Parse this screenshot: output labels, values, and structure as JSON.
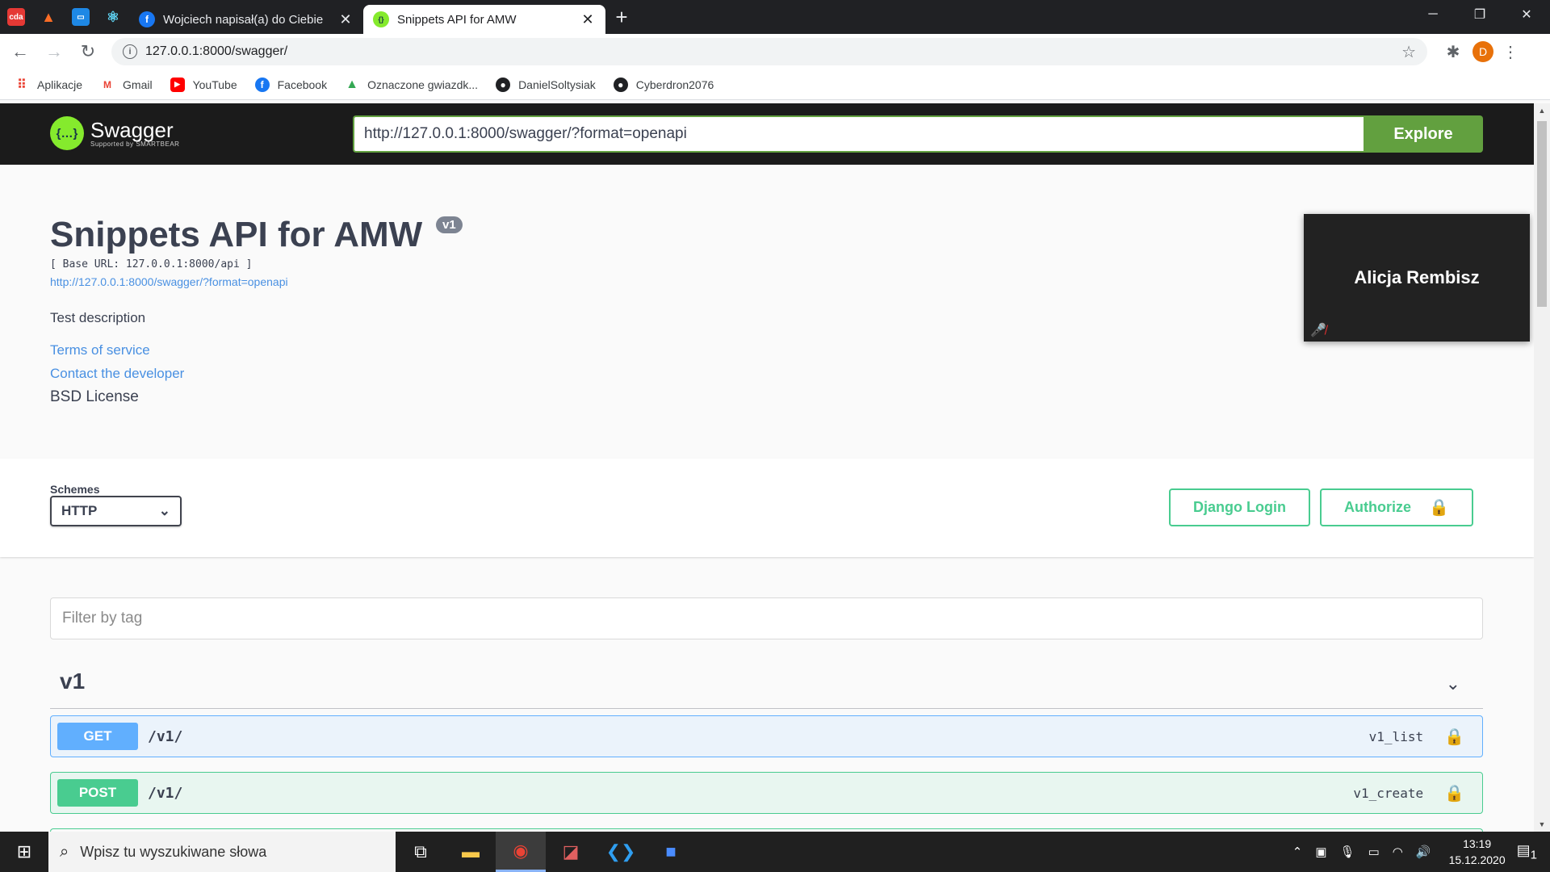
{
  "browser": {
    "pinned_tabs": [
      {
        "name": "cda",
        "label": "cda",
        "color": "#e53935"
      },
      {
        "name": "gitlab",
        "label": "",
        "color": "#fc6d26"
      },
      {
        "name": "window",
        "label": "",
        "color": "#1e88e5"
      },
      {
        "name": "react",
        "label": "",
        "color": "#61dafb"
      }
    ],
    "tabs": [
      {
        "title": "Wojciech napisał(a) do Ciebie",
        "favicon_color": "#1877f2",
        "favicon": "f",
        "active": false
      },
      {
        "title": "Snippets API for AMW",
        "favicon_color": "#85ea2d",
        "favicon": "{}",
        "active": true
      }
    ],
    "new_tab_symbol": "+",
    "window_controls": [
      "─",
      "❐",
      "✕"
    ],
    "url": "127.0.0.1:8000/swagger/",
    "profile_initial": "D",
    "bookmarks": [
      {
        "label": "Aplikacje",
        "icon": "apps-icon",
        "color": "#ea4335"
      },
      {
        "label": "Gmail",
        "icon": "gmail-icon",
        "color": "#ea4335"
      },
      {
        "label": "YouTube",
        "icon": "youtube-icon",
        "color": "#ff0000"
      },
      {
        "label": "Facebook",
        "icon": "facebook-icon",
        "color": "#1877f2"
      },
      {
        "label": "Oznaczone gwiazdk...",
        "icon": "drive-icon",
        "color": "#34a853"
      },
      {
        "label": "DanielSoltysiak",
        "icon": "github-icon",
        "color": "#202124"
      },
      {
        "label": "Cyberdron2076",
        "icon": "github-icon",
        "color": "#202124"
      }
    ]
  },
  "swagger": {
    "brand": "Swagger",
    "brand_sub": "Supported by SMARTBEAR",
    "spec_url_input": "http://127.0.0.1:8000/swagger/?format=openapi",
    "explore_label": "Explore",
    "title": "Snippets API for AMW",
    "version": "v1",
    "base_url": "[ Base URL: 127.0.0.1:8000/api ]",
    "spec_link": "http://127.0.0.1:8000/swagger/?format=openapi",
    "description": "Test description",
    "terms": "Terms of service",
    "contact": "Contact the developer",
    "license": "BSD License",
    "schemes_label": "Schemes",
    "scheme_selected": "HTTP",
    "django_login": "Django Login",
    "authorize": "Authorize",
    "filter_placeholder": "Filter by tag",
    "tag_name": "v1",
    "operations": [
      {
        "method": "GET",
        "path": "/v1/",
        "operation_id": "v1_list"
      },
      {
        "method": "POST",
        "path": "/v1/",
        "operation_id": "v1_create"
      }
    ]
  },
  "video_overlay": {
    "participant": "Alicja Rembisz"
  },
  "taskbar": {
    "search_placeholder": "Wpisz tu wyszukiwane słowa",
    "time": "13:19",
    "date": "15.12.2020",
    "notification_count": "1"
  },
  "colors": {
    "swagger_green": "#62a03f",
    "get_blue": "#61affe",
    "post_green": "#49cc90"
  }
}
